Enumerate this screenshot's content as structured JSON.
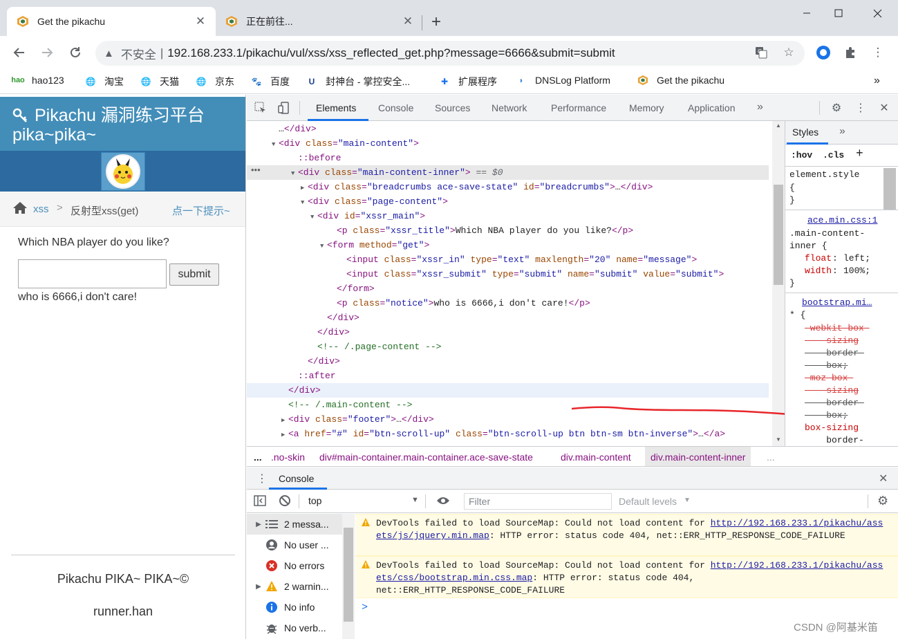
{
  "browser": {
    "tabs": [
      {
        "title": "Get the pikachu",
        "active": true
      },
      {
        "title": "正在前往...",
        "active": false
      }
    ],
    "url_insecure_label": "不安全",
    "url_separator": "|",
    "url": "192.168.233.1/pikachu/vul/xss/xss_reflected_get.php?message=6666&submit=submit",
    "bookmarks": [
      "hao123",
      "淘宝",
      "天猫",
      "京东",
      "百度",
      "封神台 - 掌控安全...",
      "扩展程序",
      "DNSLog Platform",
      "Get the pikachu"
    ],
    "bookmarks_more": "»"
  },
  "page": {
    "title_line1": "Pikachu 漏洞练习平台",
    "title_line2": "pika~pika~",
    "breadcrumb": {
      "section": "xss",
      "separator": ">",
      "current": "反射型xss(get)",
      "hint": "点一下提示~"
    },
    "question": "Which NBA player do you like?",
    "input_value": "",
    "submit_label": "submit",
    "notice": "who is 6666,i don't care!",
    "footer_line1": "Pikachu PIKA~ PIKA~©",
    "footer_line2": "runner.han"
  },
  "devtools": {
    "tabs": [
      "Elements",
      "Console",
      "Sources",
      "Network",
      "Performance",
      "Memory",
      "Application"
    ],
    "active_tab": "Elements",
    "more_tabs": "»",
    "dom_lines": [
      {
        "indent": 3,
        "arrow": "",
        "html": "…</div>"
      },
      {
        "indent": 3,
        "arrow": "▼",
        "html": "<div class=\"main-content\">"
      },
      {
        "indent": 5,
        "arrow": "",
        "html": "::before"
      },
      {
        "indent": 5,
        "arrow": "▼",
        "html": "<div class=\"main-content-inner\">",
        "suffix": " == $0"
      },
      {
        "indent": 6,
        "arrow": "▶",
        "html": "<div class=\"breadcrumbs ace-save-state\" id=\"breadcrumbs\">…</div>"
      },
      {
        "indent": 6,
        "arrow": "▼",
        "html": "<div class=\"page-content\">"
      },
      {
        "indent": 7,
        "arrow": "▼",
        "html": "<div id=\"xssr_main\">"
      },
      {
        "indent": 9,
        "arrow": "",
        "html": "<p class=\"xssr_title\">Which NBA player do you like?</p>"
      },
      {
        "indent": 8,
        "arrow": "▼",
        "html": "<form method=\"get\">"
      },
      {
        "indent": 10,
        "arrow": "",
        "html": "<input class=\"xssr_in\" type=\"text\" maxlength=\"20\" name=\"message\">"
      },
      {
        "indent": 10,
        "arrow": "",
        "html": "<input class=\"xssr_submit\" type=\"submit\" name=\"submit\" value=\"submit\">"
      },
      {
        "indent": 9,
        "arrow": "",
        "html": "</form>"
      },
      {
        "indent": 9,
        "arrow": "",
        "html": "<p class=\"notice\">who is 6666,i don't care!</p>"
      },
      {
        "indent": 8,
        "arrow": "",
        "html": "</div>"
      },
      {
        "indent": 7,
        "arrow": "",
        "html": "</div>"
      },
      {
        "indent": 7,
        "arrow": "",
        "html": "<!-- /.page-content -->"
      },
      {
        "indent": 6,
        "arrow": "",
        "html": "</div>"
      },
      {
        "indent": 5,
        "arrow": "",
        "html": "::after"
      },
      {
        "indent": 4,
        "arrow": "",
        "html": "</div>"
      },
      {
        "indent": 4,
        "arrow": "",
        "html": "<!-- /.main-content -->"
      },
      {
        "indent": 4,
        "arrow": "▶",
        "html": "<div class=\"footer\">…</div>"
      },
      {
        "indent": 4,
        "arrow": "▶",
        "html": "<a href=\"#\" id=\"btn-scroll-up\" class=\"btn-scroll-up btn btn-sm btn-inverse\">…</a>"
      }
    ],
    "styles": {
      "tab": "Styles",
      "hov": ":hov",
      "cls": ".cls",
      "rules": [
        {
          "selector": "element.style",
          "source": "",
          "body": "{\n}"
        },
        {
          "selector": ".main-content-\ninner {",
          "source": "ace.min.css:1",
          "props": [
            [
              "float",
              "left;"
            ],
            [
              "width",
              "100%;"
            ]
          ]
        },
        {
          "selector": "* {",
          "source": "bootstrap.mi…",
          "props": [
            [
              "-webkit-box-\n    sizing",
              "\n    border-\n    box;"
            ],
            [
              "-moz-box-\n    sizing",
              "\n    border-\n    box;"
            ],
            [
              "box-sizing",
              "\n    border-\n    box;"
            ]
          ]
        }
      ]
    },
    "crumbs": [
      "...",
      ".no-skin",
      "div#main-container.main-container.ace-save-state",
      "div.main-content",
      "div.main-content-inner",
      "..."
    ],
    "console": {
      "title": "Console",
      "context": "top",
      "filter_placeholder": "Filter",
      "levels": "Default levels",
      "sidebar": [
        {
          "label": "2 messa...",
          "icon": "list"
        },
        {
          "label": "No user ...",
          "icon": "user"
        },
        {
          "label": "No errors",
          "icon": "error"
        },
        {
          "label": "2 warnin...",
          "icon": "warning"
        },
        {
          "label": "No info",
          "icon": "info"
        },
        {
          "label": "No verb...",
          "icon": "verbose"
        }
      ],
      "messages": [
        {
          "prefix": "DevTools failed to load SourceMap: Could not load content for ",
          "link": "http://192.168.233.1/pikachu/assets/js/jquery.min.map",
          "suffix": ": HTTP error: status code 404, net::ERR_HTTP_RESPONSE_CODE_FAILURE"
        },
        {
          "prefix": "DevTools failed to load SourceMap: Could not load content for ",
          "link": "http://192.168.233.1/pikachu/assets/css/bootstrap.min.css.map",
          "suffix": ": HTTP error: status code 404, net::ERR_HTTP_RESPONSE_CODE_FAILURE"
        }
      ],
      "prompt": ">"
    }
  },
  "watermark": "CSDN @阿基米笛",
  "colors": {
    "page_header": "#438eb9",
    "avatar_bar": "#2c6aa0",
    "link": "#4c8fbd",
    "warning_bg": "#fffbe5",
    "annotation": "#e8262a",
    "accent": "#1a73e8"
  }
}
